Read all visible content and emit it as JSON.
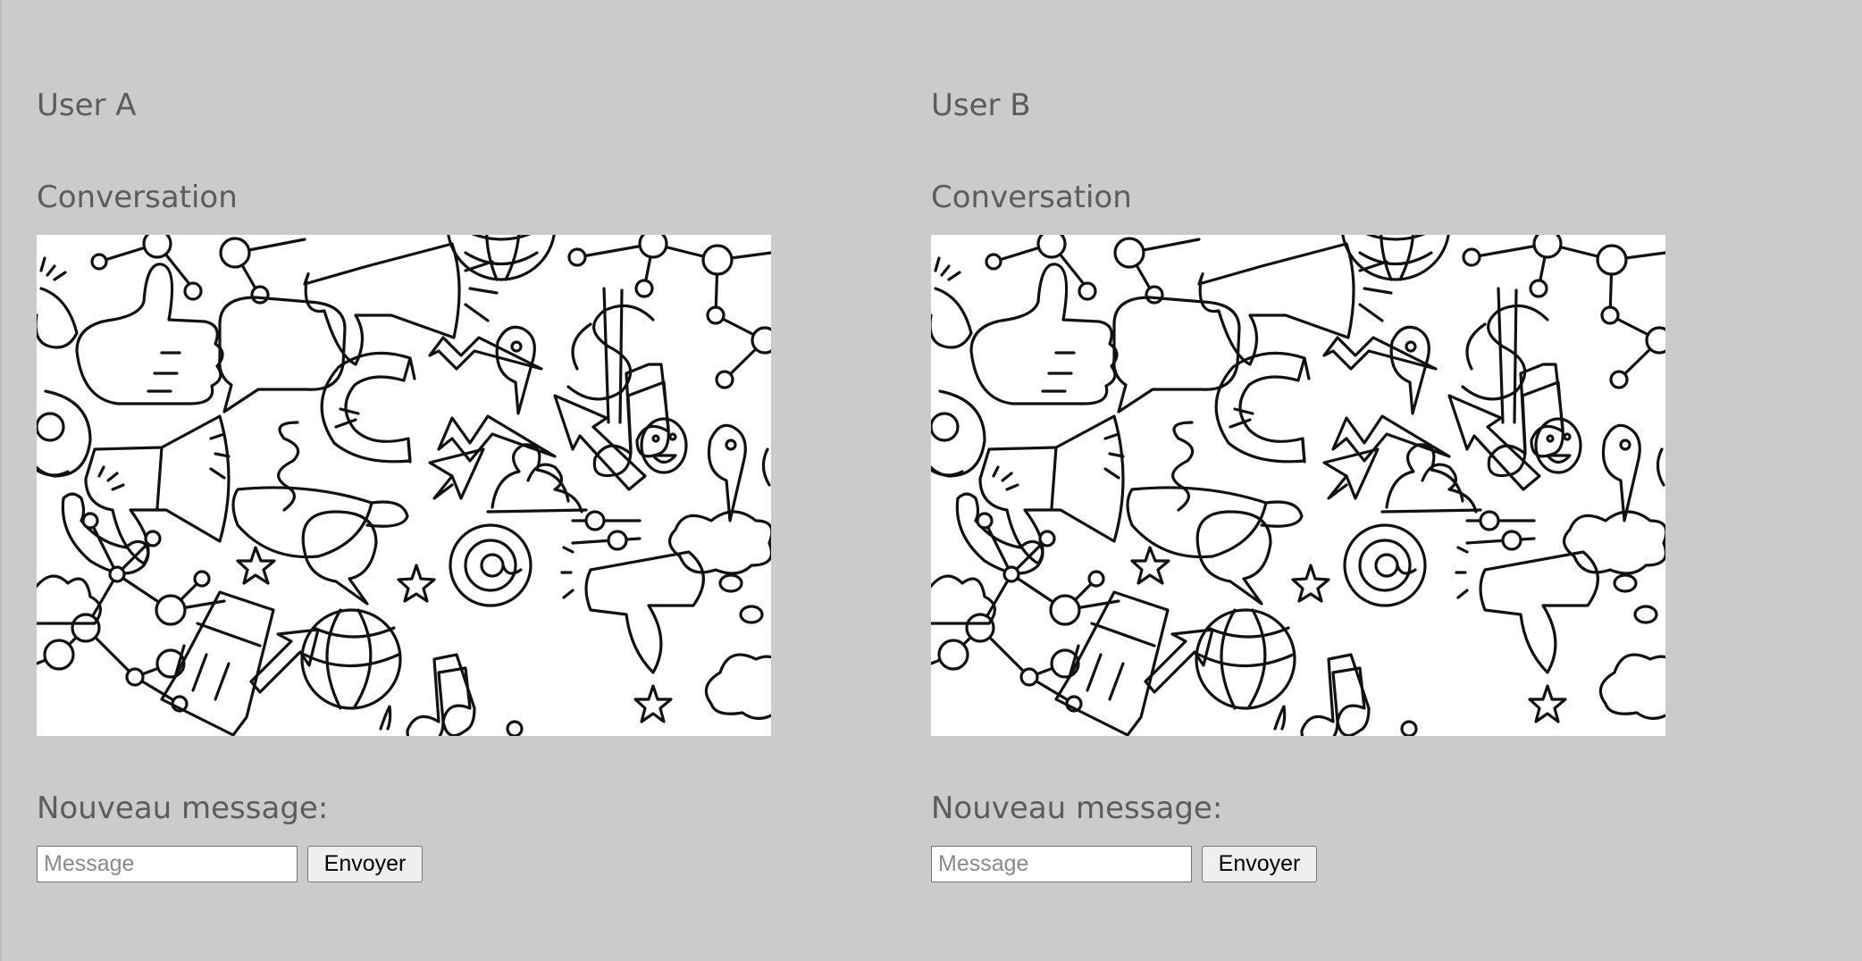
{
  "panels": [
    {
      "user_title": "User A",
      "conversation_title": "Conversation",
      "new_message_label": "Nouveau message:",
      "input_placeholder": "Message",
      "input_value": "",
      "send_label": "Envoyer"
    },
    {
      "user_title": "User B",
      "conversation_title": "Conversation",
      "new_message_label": "Nouveau message:",
      "input_placeholder": "Message",
      "input_value": "",
      "send_label": "Envoyer"
    }
  ],
  "conversation_background": {
    "icons": [
      "network-icon",
      "thumbs-up-icon",
      "speech-bubble-icon",
      "megaphone-icon",
      "globe-icon",
      "dollar-icon",
      "music-note-icon",
      "map-pin-icon",
      "at-sign-icon",
      "magnet-icon",
      "lightning-icon",
      "arrow-icon",
      "smiley-icon",
      "coffee-cup-icon",
      "paper-plane-icon",
      "people-icon",
      "sliders-icon",
      "cloud-icon",
      "phone-icon",
      "star-icon",
      "pencil-icon"
    ]
  },
  "colors": {
    "page_background": "#cbcbcb",
    "text": "#5c5c5c",
    "conversation_background": "#ffffff",
    "doodle_stroke": "#111111"
  }
}
